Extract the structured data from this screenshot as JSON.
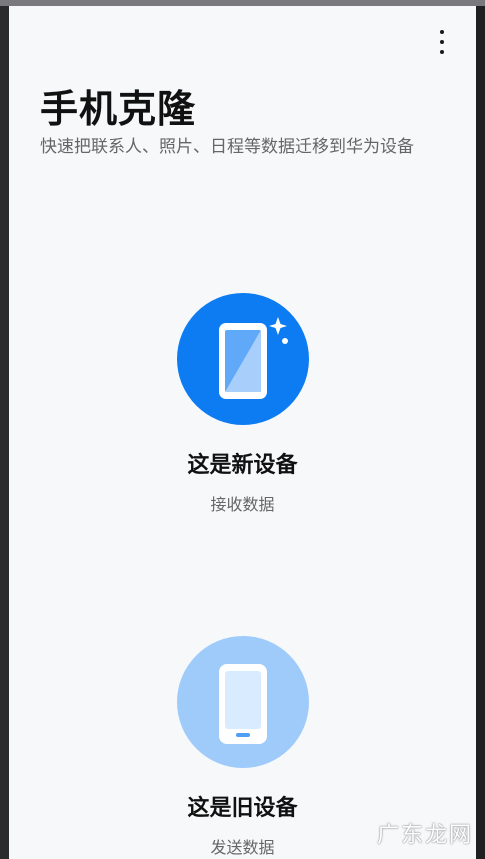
{
  "header": {
    "title": "手机克隆",
    "subtitle": "快速把联系人、照片、日程等数据迁移到华为设备",
    "menu_icon": "more-vertical-icon"
  },
  "options": {
    "new_device": {
      "label": "这是新设备",
      "description": "接收数据",
      "icon": "new-phone-sparkle-icon",
      "color": "#0d7cf2"
    },
    "old_device": {
      "label": "这是旧设备",
      "description": "发送数据",
      "icon": "old-phone-icon",
      "color": "#9fcbfb"
    }
  },
  "watermark": {
    "text": "广东龙网"
  }
}
